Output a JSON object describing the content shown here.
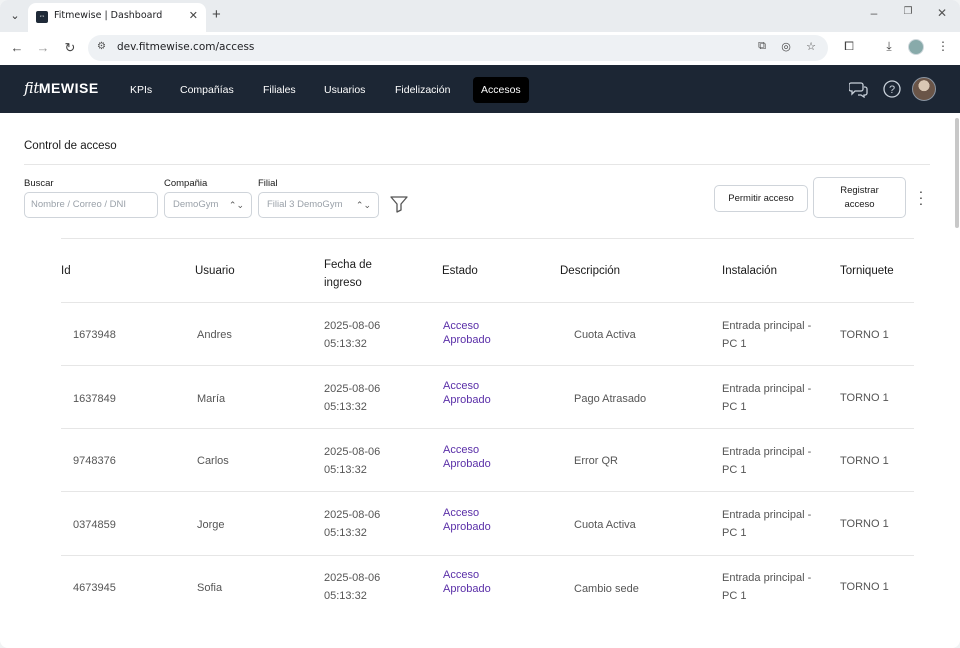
{
  "browser": {
    "tab_title": "Fitmewise | Dashboard",
    "url": "dev.fitmewise.com/access"
  },
  "app": {
    "logo_script": "fit",
    "logo_bold": "MEWISE",
    "nav": [
      {
        "label": "KPIs",
        "active": false
      },
      {
        "label": "Compañías",
        "active": false
      },
      {
        "label": "Filiales",
        "active": false
      },
      {
        "label": "Usuarios",
        "active": false
      },
      {
        "label": "Fidelización",
        "active": false
      },
      {
        "label": "Accesos",
        "active": true
      }
    ]
  },
  "page": {
    "title": "Control de acceso",
    "filters": {
      "buscar_label": "Buscar",
      "buscar_placeholder": "Nombre / Correo / DNI",
      "compania_label": "Compañia",
      "compania_value": "DemoGym",
      "filial_label": "Filial",
      "filial_value": "Filial 3 DemoGym"
    },
    "permitir_label": "Permitir acceso",
    "registrar_label": "Registrar acceso"
  },
  "table": {
    "headers": {
      "id": "Id",
      "usuario": "Usuario",
      "fecha": "Fecha de ingreso",
      "estado": "Estado",
      "descripcion": "Descripción",
      "instalacion": "Instalación",
      "torniquete": "Torniquete"
    },
    "rows": [
      {
        "id": "1673948",
        "usuario": "Andres",
        "fecha": "2025-08-06",
        "hora": "05:13:32",
        "estado": "Acceso Aprobado",
        "descripcion": "Cuota Activa",
        "instalacion": "Entrada principal - PC 1",
        "torniquete": "TORNO 1"
      },
      {
        "id": "1637849",
        "usuario": "María",
        "fecha": "2025-08-06",
        "hora": "05:13:32",
        "estado": "Acceso Aprobado",
        "descripcion": "Pago Atrasado",
        "instalacion": "Entrada principal - PC 1",
        "torniquete": "TORNO 1"
      },
      {
        "id": "9748376",
        "usuario": "Carlos",
        "fecha": "2025-08-06",
        "hora": "05:13:32",
        "estado": "Acceso Aprobado",
        "descripcion": "Error QR",
        "instalacion": "Entrada principal - PC 1",
        "torniquete": "TORNO 1"
      },
      {
        "id": "0374859",
        "usuario": "Jorge",
        "fecha": "2025-08-06",
        "hora": "05:13:32",
        "estado": "Acceso Aprobado",
        "descripcion": "Cuota Activa",
        "instalacion": "Entrada principal - PC 1",
        "torniquete": "TORNO 1"
      },
      {
        "id": "4673945",
        "usuario": "Sofia",
        "fecha": "2025-08-06",
        "hora": "05:13:32",
        "estado": "Acceso Aprobado",
        "descripcion": "Cambio sede",
        "instalacion": "Entrada principal - PC 1",
        "torniquete": "TORNO 1"
      }
    ]
  },
  "colors": {
    "header_bg": "#1c2634",
    "active_nav_bg": "#000000",
    "estado_text": "#5a2fa8"
  }
}
